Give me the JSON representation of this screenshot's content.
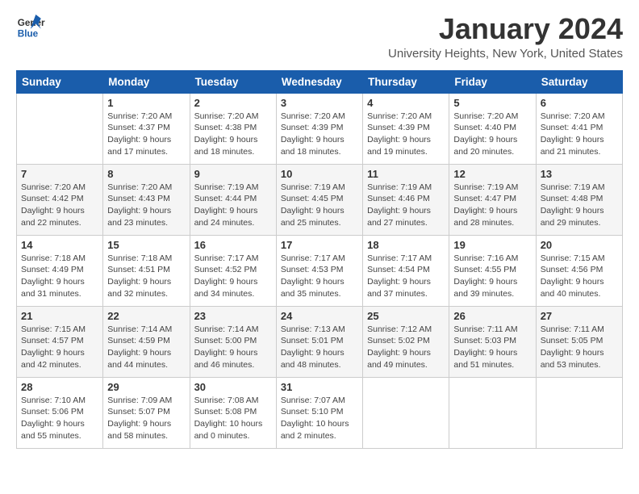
{
  "logo": {
    "line1": "General",
    "line2": "Blue"
  },
  "title": "January 2024",
  "subtitle": "University Heights, New York, United States",
  "days_of_week": [
    "Sunday",
    "Monday",
    "Tuesday",
    "Wednesday",
    "Thursday",
    "Friday",
    "Saturday"
  ],
  "weeks": [
    [
      {
        "day": "",
        "sunrise": "",
        "sunset": "",
        "daylight": ""
      },
      {
        "day": "1",
        "sunrise": "Sunrise: 7:20 AM",
        "sunset": "Sunset: 4:37 PM",
        "daylight": "Daylight: 9 hours and 17 minutes."
      },
      {
        "day": "2",
        "sunrise": "Sunrise: 7:20 AM",
        "sunset": "Sunset: 4:38 PM",
        "daylight": "Daylight: 9 hours and 18 minutes."
      },
      {
        "day": "3",
        "sunrise": "Sunrise: 7:20 AM",
        "sunset": "Sunset: 4:39 PM",
        "daylight": "Daylight: 9 hours and 18 minutes."
      },
      {
        "day": "4",
        "sunrise": "Sunrise: 7:20 AM",
        "sunset": "Sunset: 4:39 PM",
        "daylight": "Daylight: 9 hours and 19 minutes."
      },
      {
        "day": "5",
        "sunrise": "Sunrise: 7:20 AM",
        "sunset": "Sunset: 4:40 PM",
        "daylight": "Daylight: 9 hours and 20 minutes."
      },
      {
        "day": "6",
        "sunrise": "Sunrise: 7:20 AM",
        "sunset": "Sunset: 4:41 PM",
        "daylight": "Daylight: 9 hours and 21 minutes."
      }
    ],
    [
      {
        "day": "7",
        "sunrise": "Sunrise: 7:20 AM",
        "sunset": "Sunset: 4:42 PM",
        "daylight": "Daylight: 9 hours and 22 minutes."
      },
      {
        "day": "8",
        "sunrise": "Sunrise: 7:20 AM",
        "sunset": "Sunset: 4:43 PM",
        "daylight": "Daylight: 9 hours and 23 minutes."
      },
      {
        "day": "9",
        "sunrise": "Sunrise: 7:19 AM",
        "sunset": "Sunset: 4:44 PM",
        "daylight": "Daylight: 9 hours and 24 minutes."
      },
      {
        "day": "10",
        "sunrise": "Sunrise: 7:19 AM",
        "sunset": "Sunset: 4:45 PM",
        "daylight": "Daylight: 9 hours and 25 minutes."
      },
      {
        "day": "11",
        "sunrise": "Sunrise: 7:19 AM",
        "sunset": "Sunset: 4:46 PM",
        "daylight": "Daylight: 9 hours and 27 minutes."
      },
      {
        "day": "12",
        "sunrise": "Sunrise: 7:19 AM",
        "sunset": "Sunset: 4:47 PM",
        "daylight": "Daylight: 9 hours and 28 minutes."
      },
      {
        "day": "13",
        "sunrise": "Sunrise: 7:19 AM",
        "sunset": "Sunset: 4:48 PM",
        "daylight": "Daylight: 9 hours and 29 minutes."
      }
    ],
    [
      {
        "day": "14",
        "sunrise": "Sunrise: 7:18 AM",
        "sunset": "Sunset: 4:49 PM",
        "daylight": "Daylight: 9 hours and 31 minutes."
      },
      {
        "day": "15",
        "sunrise": "Sunrise: 7:18 AM",
        "sunset": "Sunset: 4:51 PM",
        "daylight": "Daylight: 9 hours and 32 minutes."
      },
      {
        "day": "16",
        "sunrise": "Sunrise: 7:17 AM",
        "sunset": "Sunset: 4:52 PM",
        "daylight": "Daylight: 9 hours and 34 minutes."
      },
      {
        "day": "17",
        "sunrise": "Sunrise: 7:17 AM",
        "sunset": "Sunset: 4:53 PM",
        "daylight": "Daylight: 9 hours and 35 minutes."
      },
      {
        "day": "18",
        "sunrise": "Sunrise: 7:17 AM",
        "sunset": "Sunset: 4:54 PM",
        "daylight": "Daylight: 9 hours and 37 minutes."
      },
      {
        "day": "19",
        "sunrise": "Sunrise: 7:16 AM",
        "sunset": "Sunset: 4:55 PM",
        "daylight": "Daylight: 9 hours and 39 minutes."
      },
      {
        "day": "20",
        "sunrise": "Sunrise: 7:15 AM",
        "sunset": "Sunset: 4:56 PM",
        "daylight": "Daylight: 9 hours and 40 minutes."
      }
    ],
    [
      {
        "day": "21",
        "sunrise": "Sunrise: 7:15 AM",
        "sunset": "Sunset: 4:57 PM",
        "daylight": "Daylight: 9 hours and 42 minutes."
      },
      {
        "day": "22",
        "sunrise": "Sunrise: 7:14 AM",
        "sunset": "Sunset: 4:59 PM",
        "daylight": "Daylight: 9 hours and 44 minutes."
      },
      {
        "day": "23",
        "sunrise": "Sunrise: 7:14 AM",
        "sunset": "Sunset: 5:00 PM",
        "daylight": "Daylight: 9 hours and 46 minutes."
      },
      {
        "day": "24",
        "sunrise": "Sunrise: 7:13 AM",
        "sunset": "Sunset: 5:01 PM",
        "daylight": "Daylight: 9 hours and 48 minutes."
      },
      {
        "day": "25",
        "sunrise": "Sunrise: 7:12 AM",
        "sunset": "Sunset: 5:02 PM",
        "daylight": "Daylight: 9 hours and 49 minutes."
      },
      {
        "day": "26",
        "sunrise": "Sunrise: 7:11 AM",
        "sunset": "Sunset: 5:03 PM",
        "daylight": "Daylight: 9 hours and 51 minutes."
      },
      {
        "day": "27",
        "sunrise": "Sunrise: 7:11 AM",
        "sunset": "Sunset: 5:05 PM",
        "daylight": "Daylight: 9 hours and 53 minutes."
      }
    ],
    [
      {
        "day": "28",
        "sunrise": "Sunrise: 7:10 AM",
        "sunset": "Sunset: 5:06 PM",
        "daylight": "Daylight: 9 hours and 55 minutes."
      },
      {
        "day": "29",
        "sunrise": "Sunrise: 7:09 AM",
        "sunset": "Sunset: 5:07 PM",
        "daylight": "Daylight: 9 hours and 58 minutes."
      },
      {
        "day": "30",
        "sunrise": "Sunrise: 7:08 AM",
        "sunset": "Sunset: 5:08 PM",
        "daylight": "Daylight: 10 hours and 0 minutes."
      },
      {
        "day": "31",
        "sunrise": "Sunrise: 7:07 AM",
        "sunset": "Sunset: 5:10 PM",
        "daylight": "Daylight: 10 hours and 2 minutes."
      },
      {
        "day": "",
        "sunrise": "",
        "sunset": "",
        "daylight": ""
      },
      {
        "day": "",
        "sunrise": "",
        "sunset": "",
        "daylight": ""
      },
      {
        "day": "",
        "sunrise": "",
        "sunset": "",
        "daylight": ""
      }
    ]
  ]
}
